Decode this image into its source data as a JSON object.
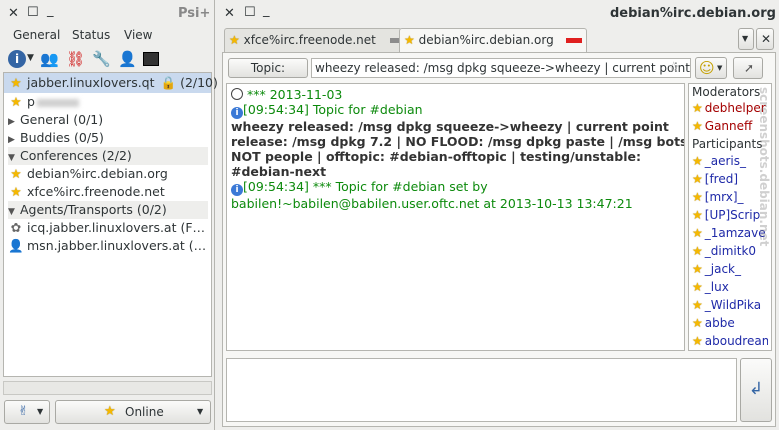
{
  "roster": {
    "title": "Psi+",
    "menu": [
      "General",
      "Status",
      "View"
    ],
    "account": {
      "name": "jabber.linuxlovers.qt",
      "count": "(2/10)"
    },
    "self_nick": "p",
    "groups": {
      "general": "General (0/1)",
      "buddies": "Buddies (0/5)",
      "conferences": "Conferences (2/2)",
      "agents": "Agents/Transports (0/2)"
    },
    "conferences": [
      "debian%irc.debian.org",
      "xfce%irc.freenode.net"
    ],
    "agents": [
      "icq.jabber.linuxlovers.at (F…",
      "msn.jabber.linuxlovers.at (…"
    ],
    "status": "Online"
  },
  "chat": {
    "window_title": "debian%irc.debian.org",
    "tabs": [
      "xfce%irc.freenode.net",
      "debian%irc.debian.org"
    ],
    "topic_label": "Topic:",
    "topic_value": "wheezy released: /msg dpkg squeeze->wheezy | current point",
    "messages": {
      "date": "*** 2013-11-03",
      "m1_head": "[09:54:34] Topic for #debian",
      "m1_body": [
        "wheezy released: /msg dpkg squeeze->wheezy | current point",
        "release: /msg dpkg 7.2 | NO FLOOD: /msg dpkg paste | /msg bots",
        "NOT people | offtopic: #debian-offtopic | testing/unstable:",
        "#debian-next"
      ],
      "m2_head": "[09:54:34] *** Topic for #debian set by",
      "m2_body": "babilen!~babilen@babilen.user.oftc.net at 2013-10-13 13:47:21"
    },
    "members": {
      "moderators_label": "Moderators",
      "moderators": [
        "debhelper",
        "Ganneff"
      ],
      "participants_label": "Participants",
      "participants": [
        "_aeris_",
        "[fred]",
        "[mrx]_",
        "[UP]Scrip",
        "_1amzave",
        "_dimitk0",
        "_jack_",
        "_lux",
        "_WildPika",
        "abbe",
        "aboudream"
      ]
    }
  },
  "watermark": "screenshots.debian.net"
}
